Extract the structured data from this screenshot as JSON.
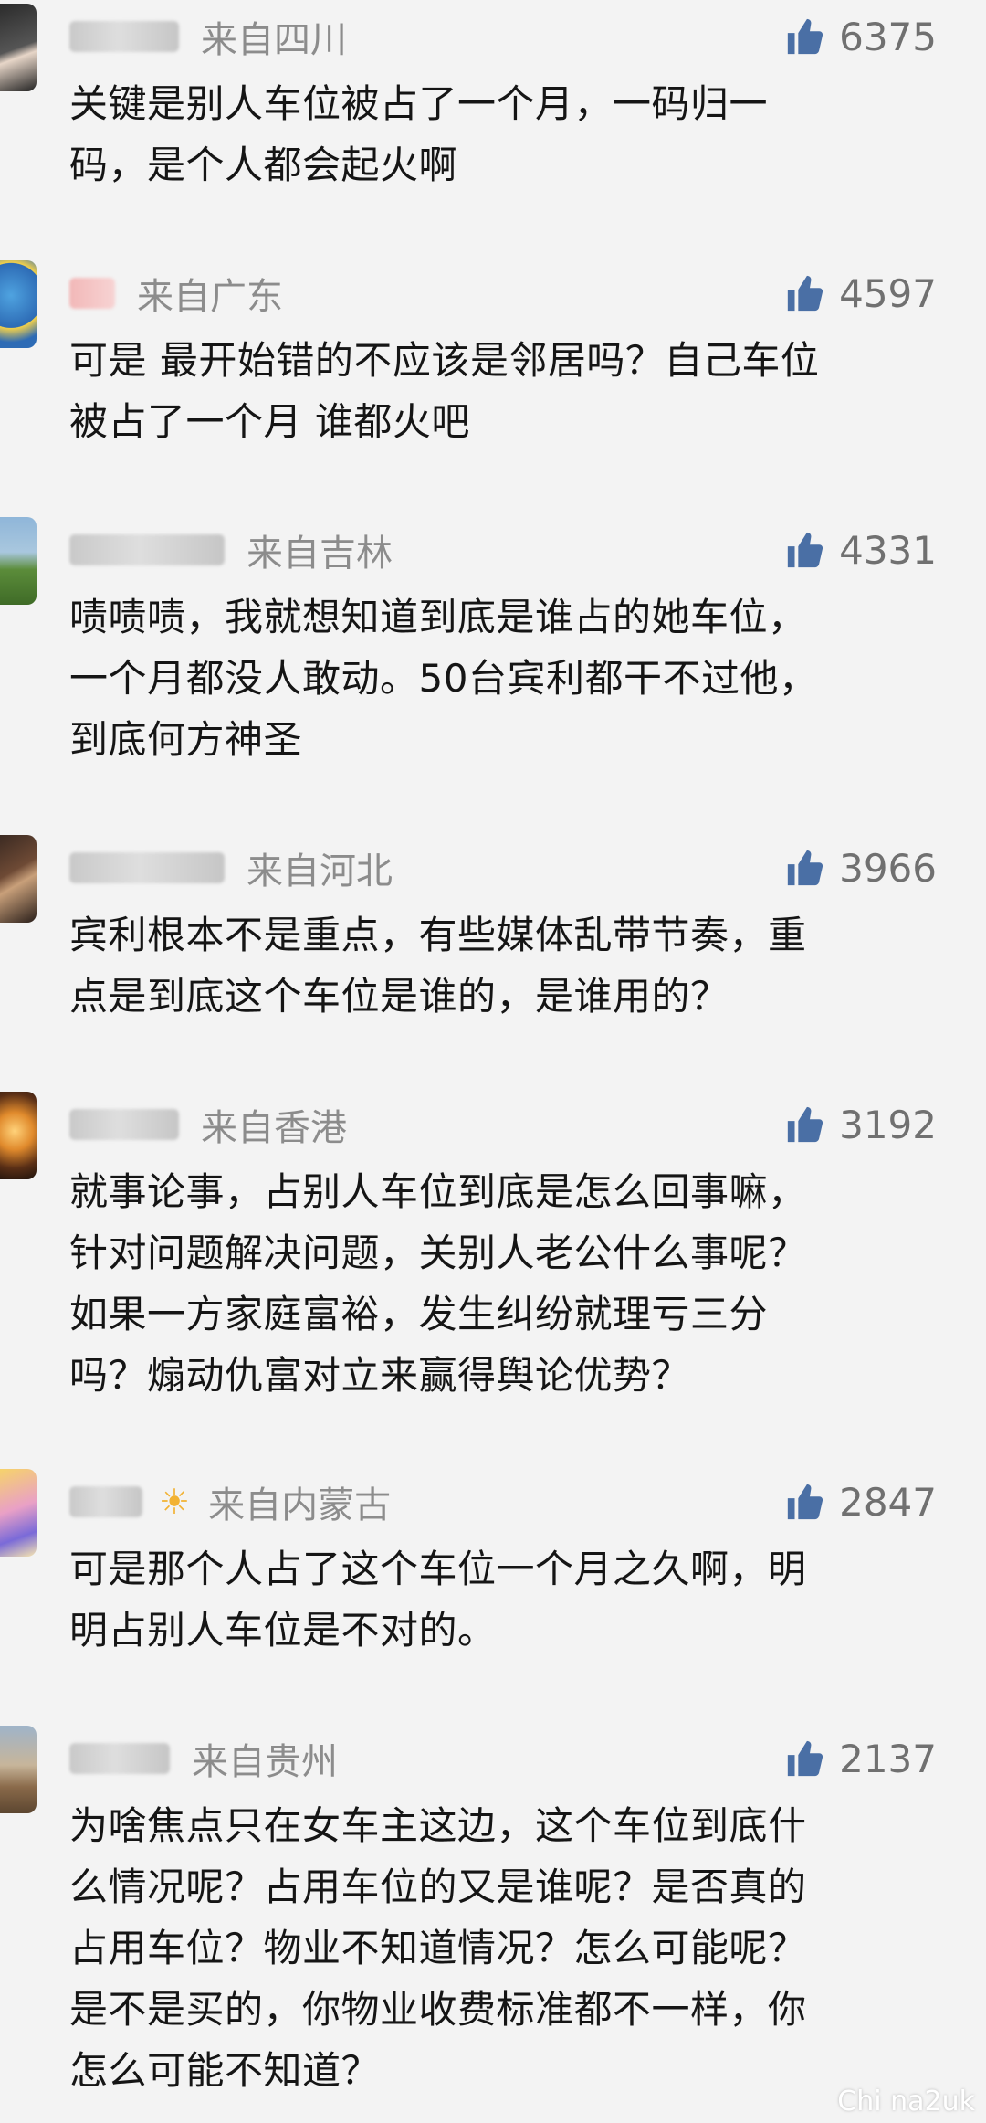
{
  "comments": [
    {
      "region": "来自四川",
      "likes": "6375",
      "text": "关键是别人车位被占了一个月，一码归一\n码，是个人都会起火啊"
    },
    {
      "region": "来自广东",
      "likes": "4597",
      "text": "可是 最开始错的不应该是邻居吗？自己车位\n被占了一个月 谁都火吧"
    },
    {
      "region": "来自吉林",
      "likes": "4331",
      "text": "啧啧啧，我就想知道到底是谁占的她车位，\n一个月都没人敢动。50台宾利都干不过他，\n到底何方神圣"
    },
    {
      "region": "来自河北",
      "likes": "3966",
      "text": "宾利根本不是重点，有些媒体乱带节奏，重\n点是到底这个车位是谁的，是谁用的？"
    },
    {
      "region": "来自香港",
      "likes": "3192",
      "text": "就事论事，占别人车位到底是怎么回事嘛，\n针对问题解决问题，关别人老公什么事呢？\n如果一方家庭富裕，发生纠纷就理亏三分\n吗？煽动仇富对立来赢得舆论优势？"
    },
    {
      "region": "来自内蒙古",
      "likes": "2847",
      "text": "可是那个人占了这个车位一个月之久啊，明\n明占别人车位是不对的。"
    },
    {
      "region": "来自贵州",
      "likes": "2137",
      "text": "为啥焦点只在女车主这边，这个车位到底什\n么情况呢？占用车位的又是谁呢？是否真的\n占用车位？物业不知道情况？怎么可能呢？\n是不是买的，你物业收费标准都不一样，你\n怎么可能不知道？"
    }
  ],
  "icons": {
    "like": "thumbs-up-icon"
  },
  "colors": {
    "accent": "#4a6fa5",
    "meta": "#8c8c8c",
    "text": "#151515",
    "background": "#f3f3f3"
  },
  "watermark": "Chi na2uk"
}
